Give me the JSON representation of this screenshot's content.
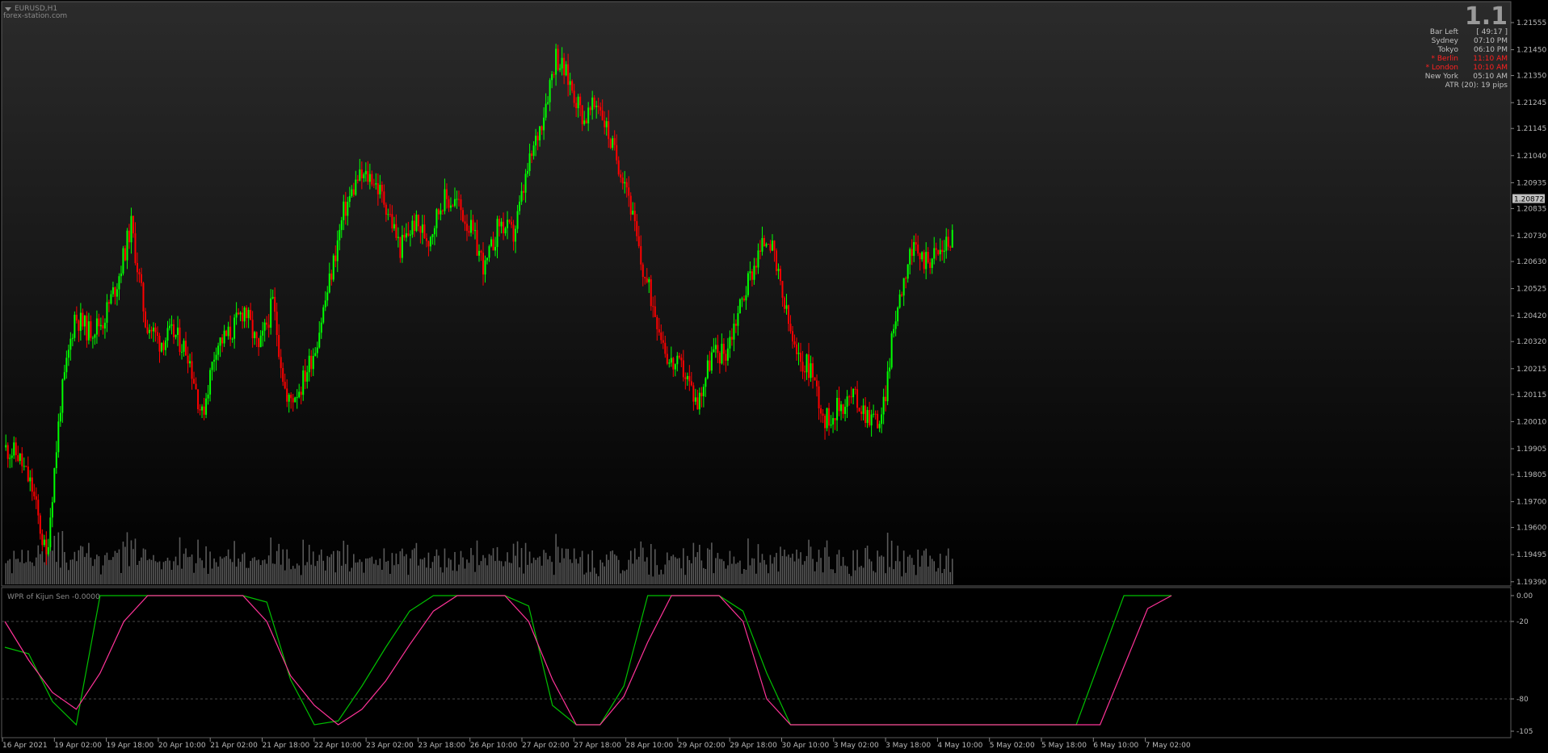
{
  "window": {
    "symbol_label": "EURUSD,H1",
    "watermark": "forex-station.com",
    "big_number": "1.1"
  },
  "info_panel": {
    "rows": [
      {
        "label": "Bar Left",
        "value": "[ 49:17 ]",
        "highlight": false
      },
      {
        "label": "Sydney",
        "value": "07:10 PM",
        "highlight": false
      },
      {
        "label": "Tokyo",
        "value": "06:10 PM",
        "highlight": false
      },
      {
        "label": "* Berlin",
        "value": "11:10 AM",
        "highlight": true
      },
      {
        "label": "* London",
        "value": "10:10 AM",
        "highlight": true
      },
      {
        "label": "New York",
        "value": "05:10 AM",
        "highlight": false
      }
    ],
    "atr_text": "ATR (20): 19 pips"
  },
  "indicator": {
    "title": "WPR of Kijun Sen -0.0000",
    "level_ticks": [
      "0.00",
      "-20",
      "-80",
      "-105"
    ]
  },
  "colors": {
    "background": "#000000",
    "bull": "#00ff00",
    "bear": "#ff0000",
    "volume": "#5a5a5a",
    "grid": "#4a4a4a",
    "wpr_line": "#00c000",
    "signal_line": "#ff3399",
    "info_red": "#ff2020",
    "price_box": "#c0c0c0"
  },
  "chart_data": [
    {
      "type": "candlestick",
      "title": "EURUSD,H1",
      "price_axis_ticks": [
        1.21555,
        1.2145,
        1.2135,
        1.21245,
        1.21145,
        1.2104,
        1.20935,
        1.20835,
        1.2073,
        1.2063,
        1.20525,
        1.2042,
        1.2032,
        1.20215,
        1.20115,
        1.2001,
        1.19905,
        1.19805,
        1.197,
        1.196,
        1.19495,
        1.1939
      ],
      "price_axis_labels": [
        "1.21555",
        "1.21450",
        "1.21350",
        "1.21245",
        "1.21145",
        "1.21040",
        "1.20935",
        "1.20835",
        "1.20730",
        "1.20630",
        "1.20525",
        "1.20420",
        "1.20320",
        "1.20215",
        "1.20115",
        "1.20010",
        "1.19905",
        "1.19805",
        "1.19700",
        "1.19600",
        "1.19495",
        "1.19390"
      ],
      "current_price": "1.20872",
      "ylim": [
        1.1938,
        1.2163
      ],
      "time_axis_labels": [
        "16 Apr 2021",
        "19 Apr 02:00",
        "19 Apr 18:00",
        "20 Apr 10:00",
        "21 Apr 02:00",
        "21 Apr 18:00",
        "22 Apr 10:00",
        "23 Apr 02:00",
        "23 Apr 18:00",
        "26 Apr 10:00",
        "27 Apr 02:00",
        "27 Apr 18:00",
        "28 Apr 10:00",
        "29 Apr 02:00",
        "29 Apr 18:00",
        "30 Apr 10:00",
        "3 May 02:00",
        "3 May 18:00",
        "4 May 10:00",
        "5 May 02:00",
        "5 May 18:00",
        "6 May 10:00",
        "7 May 02:00"
      ],
      "closes": [
        1.1991,
        1.1988,
        1.1975,
        1.1948,
        1.2008,
        1.2042,
        1.2036,
        1.204,
        1.2055,
        1.2077,
        1.204,
        1.2032,
        1.2035,
        1.2028,
        1.2003,
        1.2031,
        1.2035,
        1.2045,
        1.2028,
        1.2047,
        1.2008,
        1.2015,
        1.203,
        1.2055,
        1.2082,
        1.2095,
        1.2096,
        1.2085,
        1.2068,
        1.2078,
        1.2072,
        1.2087,
        1.2086,
        1.2075,
        1.206,
        1.2078,
        1.2073,
        1.2098,
        1.2118,
        1.2143,
        1.2132,
        1.2118,
        1.2125,
        1.2107,
        1.2093,
        1.2062,
        1.2044,
        1.2024,
        1.2021,
        1.2008,
        1.2027,
        1.2028,
        1.2046,
        1.2062,
        1.2074,
        1.2049,
        1.2025,
        1.2022,
        1.2001,
        1.2007,
        1.2011,
        1.2004,
        1.2001,
        1.2043,
        1.2067,
        1.2064,
        1.2066,
        1.2073
      ],
      "volume_range": [
        0,
        100
      ]
    },
    {
      "type": "line",
      "title": "WPR of Kijun Sen -0.0000",
      "ylim": [
        -105,
        0
      ],
      "y_ticks": [
        0,
        -20,
        -80,
        -105
      ],
      "series": [
        {
          "values": [
            -40,
            -45,
            -82,
            -100,
            0,
            0,
            0,
            0,
            0,
            0,
            0,
            -5,
            -65,
            -100,
            -97,
            -70,
            -40,
            -12,
            0,
            0,
            0,
            0,
            -8,
            -85,
            -100,
            -100,
            -70,
            0,
            0,
            0,
            0,
            -12,
            -60,
            -100,
            -100,
            -100,
            -100,
            -100,
            -100,
            -100,
            -100,
            -100,
            -100,
            -100,
            -100,
            -100,
            -50,
            0,
            0,
            0
          ]
        },
        {
          "values": [
            -20,
            -50,
            -75,
            -88,
            -60,
            -20,
            0,
            0,
            0,
            0,
            0,
            -20,
            -62,
            -85,
            -100,
            -88,
            -66,
            -38,
            -12,
            0,
            0,
            0,
            -20,
            -65,
            -100,
            -100,
            -78,
            -36,
            0,
            0,
            0,
            -20,
            -80,
            -100,
            -100,
            -100,
            -100,
            -100,
            -100,
            -100,
            -100,
            -100,
            -100,
            -100,
            -100,
            -100,
            -100,
            -55,
            -10,
            0
          ]
        }
      ]
    }
  ]
}
